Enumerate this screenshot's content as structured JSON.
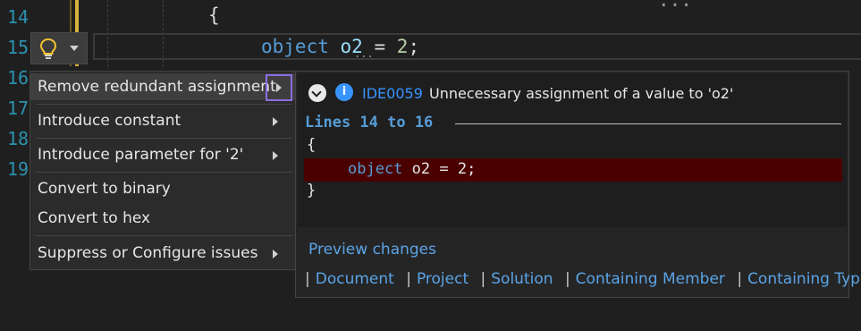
{
  "editor": {
    "line_numbers": [
      "14",
      "15",
      "16",
      "17",
      "18",
      "19"
    ],
    "brace_line": "{",
    "current_line": {
      "keyword": "object",
      "identifier": "o2",
      "operator": "=",
      "value": "2",
      "terminator": ";"
    },
    "top_ellipsis": "...",
    "squiggle": "..."
  },
  "menu": {
    "items": [
      {
        "label": "Remove redundant assignment",
        "has_submenu": true,
        "selected": true
      },
      {
        "label": "Introduce constant",
        "has_submenu": true
      },
      {
        "label": "Introduce parameter for '2'",
        "has_submenu": true
      },
      {
        "label": "Convert to binary",
        "has_submenu": false
      },
      {
        "label": "Convert to hex",
        "has_submenu": false
      },
      {
        "label": "Suppress or Configure issues",
        "has_submenu": true
      }
    ]
  },
  "preview": {
    "diagnostic_id": "IDE0059",
    "diagnostic_message": "Unnecessary assignment of a value to 'o2'",
    "lines_header": "Lines 14 to 16",
    "code": {
      "open": "{",
      "keyword": "object",
      "identifier": "o2",
      "rest": " = 2;",
      "close": "}"
    },
    "preview_changes": "Preview changes",
    "scopes": [
      "Document",
      "Project",
      "Solution",
      "Containing Member",
      "Containing Type"
    ],
    "separator": "|"
  },
  "colors": {
    "accent": "#3794ff",
    "selection_border": "#8a6fe0",
    "removed_line": "#4b0000",
    "line_number": "#2b91af"
  }
}
